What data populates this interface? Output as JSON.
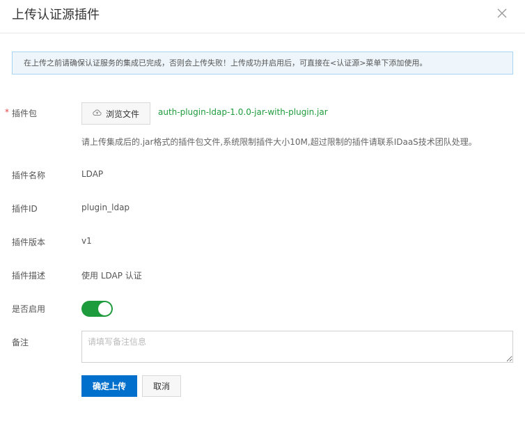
{
  "dialog": {
    "title": "上传认证源插件",
    "close_icon": "close-icon"
  },
  "notice": {
    "text": "在上传之前请确保认证服务的集成已完成，否则会上传失败！上传成功并启用后，可直接在<认证源>菜单下添加使用。"
  },
  "form": {
    "package": {
      "label": "插件包",
      "required_mark": "*",
      "browse_label": "浏览文件",
      "browse_icon": "cloud-upload-icon",
      "file_name": "auth-plugin-ldap-1.0.0-jar-with-plugin.jar",
      "hint": "请上传集成后的.jar格式的插件包文件,系统限制插件大小10M,超过限制的插件请联系IDaaS技术团队处理。"
    },
    "name": {
      "label": "插件名称",
      "value": "LDAP"
    },
    "id": {
      "label": "插件ID",
      "value": "plugin_ldap"
    },
    "version": {
      "label": "插件版本",
      "value": "v1"
    },
    "description": {
      "label": "插件描述",
      "value": "使用 LDAP 认证"
    },
    "enabled": {
      "label": "是否启用",
      "on": true
    },
    "remark": {
      "label": "备注",
      "placeholder": "请填写备注信息",
      "value": ""
    }
  },
  "actions": {
    "confirm_label": "确定上传",
    "cancel_label": "取消"
  },
  "colors": {
    "primary": "#0070cc",
    "success": "#1e9b3c",
    "required": "#e54545",
    "notice_bg": "#eef6fc",
    "notice_border": "#a8d3f1"
  }
}
